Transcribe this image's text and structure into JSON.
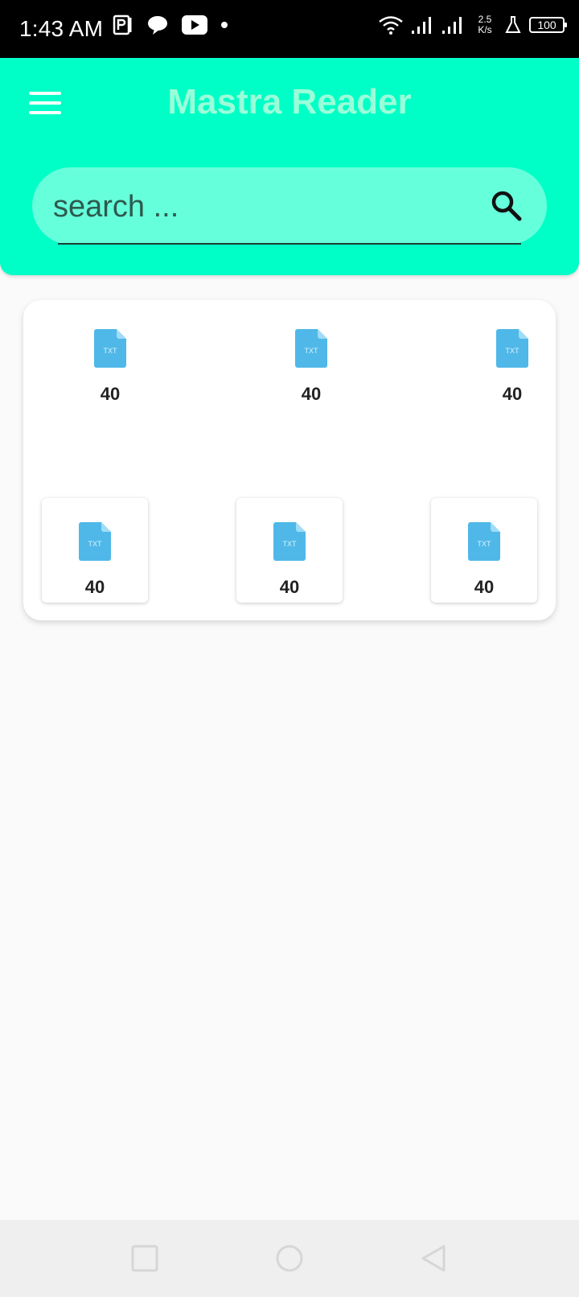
{
  "status_bar": {
    "time": "1:43 AM",
    "speed_top": "2.5",
    "speed_bottom": "K/s",
    "battery": "100",
    "icons_left": [
      "parking-icon",
      "chat-bubble-icon",
      "youtube-icon",
      "dot-icon"
    ],
    "icons_right": [
      "wifi-icon",
      "signal-icon",
      "signal-icon",
      "flask-icon",
      "battery-icon"
    ]
  },
  "header": {
    "title": "Mastra Reader",
    "background_color": "#00ffc6",
    "title_color": "#9affd9"
  },
  "search": {
    "placeholder": "search ...",
    "value": "",
    "field_color": "#66ffdb"
  },
  "files": {
    "items": [
      {
        "label": "40",
        "icon": "txt-file-icon",
        "framed": false
      },
      {
        "label": "40",
        "icon": "txt-file-icon",
        "framed": false
      },
      {
        "label": "40",
        "icon": "txt-file-icon",
        "framed": false
      },
      {
        "label": "40",
        "icon": "txt-file-icon",
        "framed": true
      },
      {
        "label": "40",
        "icon": "txt-file-icon",
        "framed": true
      },
      {
        "label": "40",
        "icon": "txt-file-icon",
        "framed": true
      }
    ],
    "icon_color": "#4fb8e8",
    "icon_text": "TXT"
  },
  "nav": {
    "buttons": [
      "recent-apps-icon",
      "home-icon",
      "back-icon"
    ]
  }
}
